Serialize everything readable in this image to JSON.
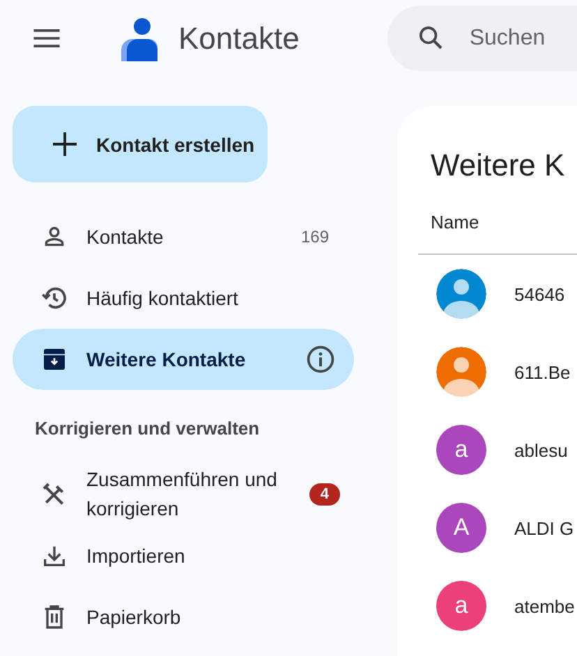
{
  "header": {
    "title": "Kontakte",
    "search": {
      "placeholder": "Suchen"
    }
  },
  "create_button": {
    "label": "Kontakt erstellen"
  },
  "sidebar": {
    "items": [
      {
        "kind": "person",
        "label": "Kontakte",
        "count": "169",
        "selected": false
      },
      {
        "kind": "history",
        "label": "Häufig kontaktiert",
        "selected": false
      },
      {
        "kind": "archive",
        "label": "Weitere Kontakte",
        "selected": true,
        "info": true
      }
    ],
    "section_title": "Korrigieren und verwalten",
    "manage_items": [
      {
        "kind": "tools",
        "label": "Zusammenführen und korrigieren",
        "badge": "4"
      },
      {
        "kind": "download",
        "label": "Importieren"
      },
      {
        "kind": "trash",
        "label": "Papierkorb"
      }
    ]
  },
  "main": {
    "title": "Weitere K",
    "column": "Name",
    "rows": [
      {
        "kind": "silhouette",
        "color": "#0288d1",
        "name": "54646"
      },
      {
        "kind": "silhouette",
        "color": "#ef6c00",
        "name": "611.Be"
      },
      {
        "kind": "letter",
        "letter": "a",
        "color": "#ab47bc",
        "name": "ablesu"
      },
      {
        "kind": "letter",
        "letter": "A",
        "color": "#ab47bc",
        "name": "ALDI G"
      },
      {
        "kind": "letter",
        "letter": "a",
        "color": "#ec407a",
        "name": "atembe"
      }
    ]
  }
}
